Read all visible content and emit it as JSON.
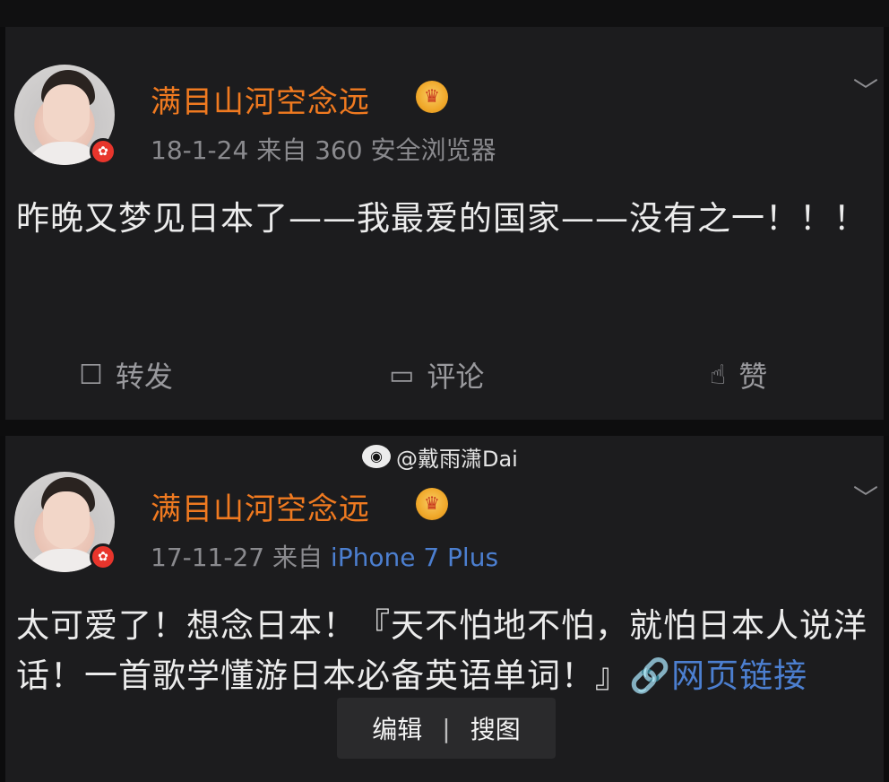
{
  "posts": [
    {
      "username": "满目山河空念远",
      "verified_badge": "✿",
      "vip_icon": "crown-icon",
      "date": "18-1-24",
      "source_prefix": "来自",
      "source": "360 安全浏览器",
      "text": "昨晚又梦见日本了——我最爱的国家——没有之一！！！",
      "actions": {
        "repost": "转发",
        "comment": "评论",
        "like": "赞"
      }
    },
    {
      "username": "满目山河空念远",
      "verified_badge": "✿",
      "vip_icon": "crown-icon",
      "date": "17-11-27",
      "source_prefix": "来自",
      "source": "iPhone 7 Plus",
      "text_main": "太可爱了！想念日本！『天不怕地不怕，就怕日本人说洋话！一首歌学懂游日本必备英语单词！』",
      "link_text": "网页链接"
    }
  ],
  "watermark": "@戴雨潇Dai",
  "edit_bar": {
    "edit": "编辑",
    "separator": "|",
    "search_image": "搜图"
  },
  "colors": {
    "username": "#f07a20",
    "link": "#4c7fd0",
    "card_bg": "#1c1c1e"
  }
}
